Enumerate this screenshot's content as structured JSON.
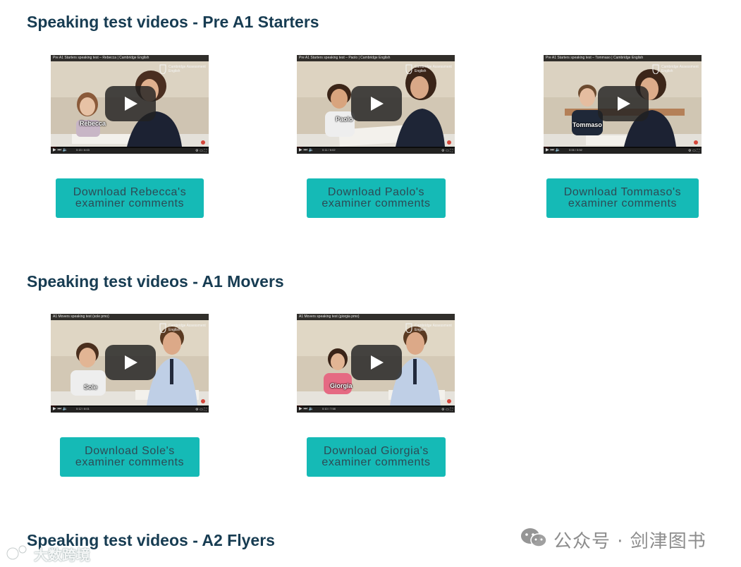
{
  "sections": [
    {
      "title": "Speaking test videos - Pre A1 Starters",
      "videos": [
        {
          "title": "Pre A1 Starters speaking test – Rebecca | Cambridge English",
          "caption": "Rebecca",
          "time": "0:15 / 6:03",
          "button_line1": "Download Rebecca's",
          "button_line2": "examiner comments"
        },
        {
          "title": "Pre A1 Starters speaking test – Paolo | Cambridge English",
          "caption": "Paolo",
          "time": "0:11 / 6:02",
          "button_line1": "Download Paolo's",
          "button_line2": "examiner comments"
        },
        {
          "title": "Pre A1 Starters speaking test – Tommaso | Cambridge English",
          "caption": "Tommaso",
          "time": "0:06 / 5:52",
          "button_line1": "Download Tommaso's",
          "button_line2": "examiner comments"
        }
      ]
    },
    {
      "title": "Speaking test videos - A1 Movers",
      "videos": [
        {
          "title": "A1 Movers speaking test (sole pmo)",
          "caption": "Sole",
          "time": "0:12 / 8:01",
          "button_line1": "Download Sole's",
          "button_line2": "examiner comments"
        },
        {
          "title": "A1 Movers speaking test (giorgia pmo)",
          "caption": "Giorgia",
          "time": "0:10 / 7:58",
          "button_line1": "Download Giorgia's",
          "button_line2": "examiner comments"
        }
      ]
    },
    {
      "title": "Speaking test videos - A2 Flyers",
      "videos": []
    }
  ],
  "video_logo": {
    "line1": "Cambridge Assessment",
    "line2": "English"
  },
  "watermarks": {
    "wechat": "公众号 · 剑津图书",
    "corner": "大数跨境"
  },
  "colors": {
    "heading": "#173c52",
    "button": "#15bab6",
    "button_text": "#2d4a55"
  }
}
